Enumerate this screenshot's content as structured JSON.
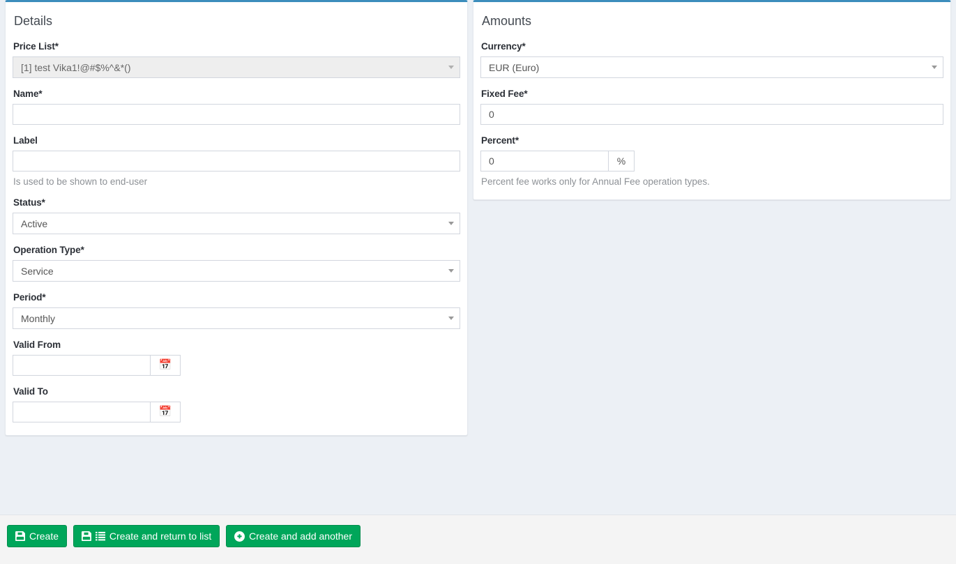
{
  "theme": {
    "panel_accent": "#3c8dbc",
    "page_background": "#ecf0f5",
    "footer_background": "#f4f4f4",
    "button_green": "#00a65a",
    "button_green_border": "#008d4c",
    "label_color": "#2b2f36",
    "help_text_color": "#8d9196"
  },
  "details_panel": {
    "title": "Details",
    "price_list": {
      "label": "Price List*",
      "value": "[1] test Vika1!@#$%^&*()",
      "disabled": true,
      "caret_icon": "chevron-down-icon"
    },
    "name": {
      "label": "Name*",
      "value": "",
      "placeholder": ""
    },
    "label_field": {
      "label": "Label",
      "value": "",
      "placeholder": "",
      "help": "Is used to be shown to end-user"
    },
    "status": {
      "label": "Status*",
      "value": "Active",
      "caret_icon": "chevron-down-icon"
    },
    "operation_type": {
      "label": "Operation Type*",
      "value": "Service",
      "caret_icon": "chevron-down-icon"
    },
    "period": {
      "label": "Period*",
      "value": "Monthly",
      "caret_icon": "chevron-down-icon"
    },
    "valid_from": {
      "label": "Valid From",
      "value": "",
      "placeholder": "",
      "addon_icon": "calendar-icon",
      "addon_glyph": "📅"
    },
    "valid_to": {
      "label": "Valid To",
      "value": "",
      "placeholder": "",
      "addon_icon": "calendar-icon",
      "addon_glyph": "📅"
    }
  },
  "amounts_panel": {
    "title": "Amounts",
    "currency": {
      "label": "Currency*",
      "value": "EUR (Euro)",
      "caret_icon": "chevron-down-icon"
    },
    "fixed_fee": {
      "label": "Fixed Fee*",
      "value": "0",
      "placeholder": ""
    },
    "percent": {
      "label": "Percent*",
      "value": "0",
      "placeholder": "",
      "addon_text": "%",
      "help": "Percent fee works only for Annual Fee operation types."
    }
  },
  "form_actions": {
    "buttons": [
      {
        "label": "Create",
        "icons": [
          "save-icon"
        ]
      },
      {
        "label": "Create and return to list",
        "icons": [
          "save-icon",
          "list-icon"
        ]
      },
      {
        "label": "Create and add another",
        "icons": [
          "plus-circle-icon"
        ]
      }
    ]
  }
}
